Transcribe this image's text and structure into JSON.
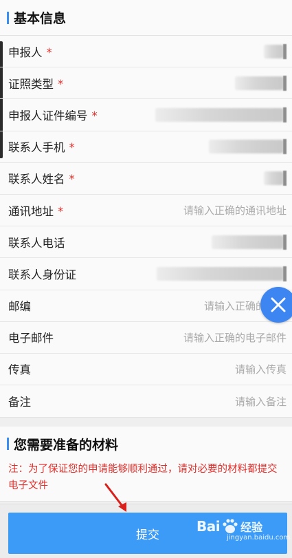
{
  "basic_info": {
    "title": "基本信息",
    "fields": [
      {
        "label": "申报人",
        "required": true,
        "placeholder": "",
        "has_value": true
      },
      {
        "label": "证照类型",
        "required": true,
        "placeholder": "",
        "has_value": true
      },
      {
        "label": "申报人证件编号",
        "required": true,
        "placeholder": "",
        "has_value": true
      },
      {
        "label": "联系人手机",
        "required": true,
        "placeholder": "",
        "has_value": true
      },
      {
        "label": "联系人姓名",
        "required": true,
        "placeholder": "",
        "has_value": true
      },
      {
        "label": "通讯地址",
        "required": true,
        "placeholder": "请输入正确的通讯地址",
        "has_value": false
      },
      {
        "label": "联系人电话",
        "required": false,
        "placeholder": "",
        "has_value": true
      },
      {
        "label": "联系人身份证",
        "required": false,
        "placeholder": "",
        "has_value": true
      },
      {
        "label": "邮编",
        "required": false,
        "placeholder": "请输入正确的",
        "has_value": false
      },
      {
        "label": "电子邮件",
        "required": false,
        "placeholder": "请输入正确的电子邮件",
        "has_value": false
      },
      {
        "label": "传真",
        "required": false,
        "placeholder": "请输入传真",
        "has_value": false
      },
      {
        "label": "备注",
        "required": false,
        "placeholder": "请输入备注",
        "has_value": false
      }
    ],
    "required_mark": "*"
  },
  "materials": {
    "title": "您需要准备的材料",
    "note": "注：为了保证您的申请能够顺利通过，请对必要的材料都提交电子文件"
  },
  "submit_label": "提交",
  "close_icon": "close-icon",
  "watermark": {
    "main": "Bai",
    "brand": "经验",
    "sub": "jingyan.baidu.com"
  },
  "colors": {
    "accent": "#3a8ff0",
    "required": "#e0302c",
    "submit": "#3c9bf7",
    "close_fab": "#3d86f2",
    "arrow": "#d8201c"
  }
}
